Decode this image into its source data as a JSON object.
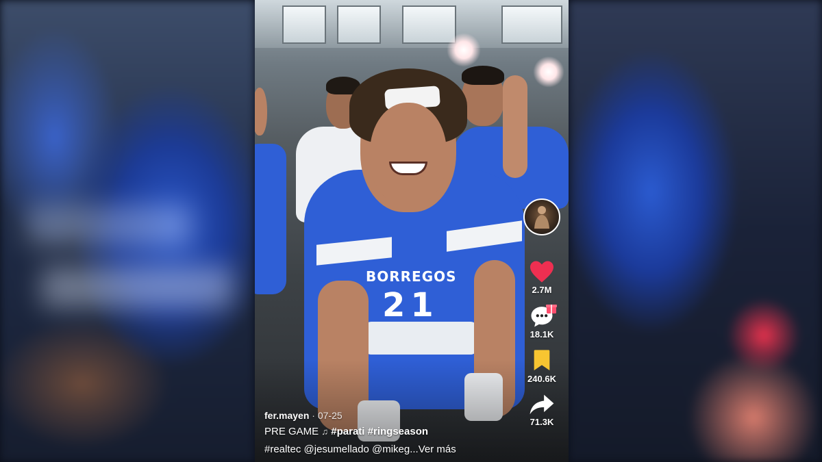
{
  "post": {
    "username": "fer.mayen",
    "date": "07-25",
    "caption_line1_prefix": "PRE GAME",
    "caption_line1_tags": [
      "#parati",
      "#ringseason"
    ],
    "caption_line2": "#realtec @jesumellado @mikeg...Ver más"
  },
  "jersey": {
    "team_text": "BORREGOS",
    "number": "21"
  },
  "actions": {
    "likes": "2.7M",
    "comments": "18.1K",
    "saves": "240.6K",
    "shares": "71.3K"
  },
  "icons": [
    "profile-avatar",
    "heart-icon",
    "comment-icon",
    "gift-icon",
    "bookmark-icon",
    "share-icon",
    "music-note-icon"
  ],
  "colors": {
    "like": "#ee2f51",
    "bookmark": "#f7c531",
    "jersey_blue": "#2f5fd6"
  }
}
